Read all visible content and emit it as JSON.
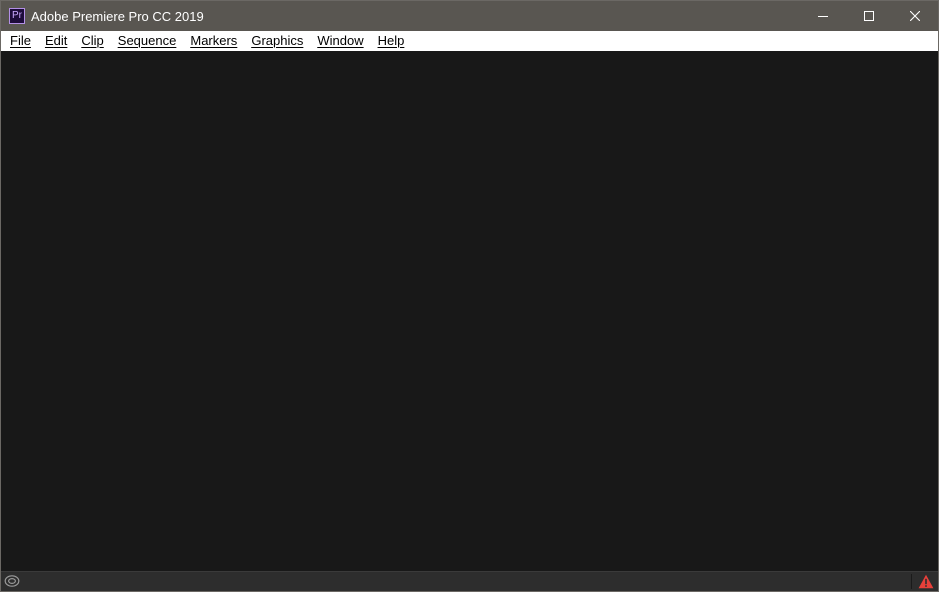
{
  "window": {
    "title": "Adobe Premiere Pro CC 2019",
    "app_icon_label": "Pr"
  },
  "menu": {
    "items": [
      {
        "label": "File"
      },
      {
        "label": "Edit"
      },
      {
        "label": "Clip"
      },
      {
        "label": "Sequence"
      },
      {
        "label": "Markers"
      },
      {
        "label": "Graphics"
      },
      {
        "label": "Window"
      },
      {
        "label": "Help"
      }
    ]
  },
  "status": {
    "left_icon": "creative-cloud-icon",
    "right_icon": "warning-icon"
  },
  "colors": {
    "titlebar": "#595651",
    "menubar": "#ffffff",
    "workspace": "#181818",
    "statusbar": "#2d2d2d",
    "warning": "#e8403a",
    "app_icon_bg": "#1d0b3a",
    "app_icon_accent": "#b38fe6"
  }
}
